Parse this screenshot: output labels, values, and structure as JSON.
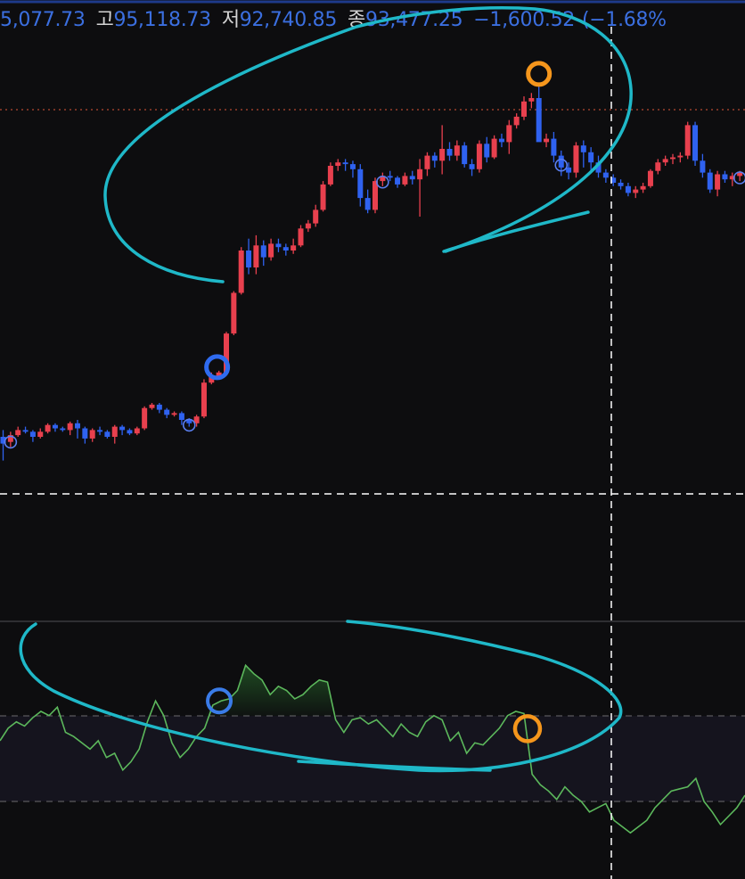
{
  "ohlc_header": {
    "open_value": "5,077.73",
    "high_label": "고",
    "high_value": "95,118.73",
    "low_label": "저",
    "low_value": "92,740.85",
    "close_label": "종",
    "close_value": "93,477.25",
    "change_value": "−1,600.52",
    "change_pct": "(−1.68%"
  },
  "colors": {
    "background": "#0d0d0f",
    "up_candle": "#e8404e",
    "down_candle": "#2f62f0",
    "annotation": "#1fb8c8",
    "marker_orange": "#f5961c",
    "marker_blue": "#2f6bf0",
    "indicator_line": "#5cb85c",
    "header_text": "#3b6fe0"
  },
  "chart_data": [
    {
      "type": "candlestick",
      "candles": [
        [
          0,
          4,
          -14,
          -4
        ],
        [
          -3,
          3,
          -6,
          1
        ],
        [
          1,
          6,
          0,
          4
        ],
        [
          4,
          6,
          2,
          3
        ],
        [
          3,
          4,
          -3,
          0
        ],
        [
          0,
          5,
          -1,
          3
        ],
        [
          3,
          8,
          2,
          7
        ],
        [
          7,
          8,
          3,
          5
        ],
        [
          5,
          6,
          3,
          4
        ],
        [
          4,
          9,
          1,
          8
        ],
        [
          8,
          10,
          -1,
          5
        ],
        [
          5,
          6,
          -4,
          -1
        ],
        [
          -1,
          5,
          -3,
          4
        ],
        [
          4,
          6,
          1,
          3
        ],
        [
          3,
          4,
          -1,
          0
        ],
        [
          0,
          7,
          -4,
          6
        ],
        [
          6,
          7,
          1,
          4
        ],
        [
          4,
          5,
          1,
          2
        ],
        [
          2,
          6,
          1,
          5
        ],
        [
          5,
          18,
          4,
          17
        ],
        [
          17,
          20,
          16,
          19
        ],
        [
          19,
          20,
          14,
          16
        ],
        [
          16,
          17,
          11,
          13
        ],
        [
          13,
          15,
          12,
          14
        ],
        [
          14,
          15,
          7,
          10
        ],
        [
          10,
          11,
          6,
          8
        ],
        [
          8,
          13,
          6,
          12
        ],
        [
          12,
          34,
          11,
          32
        ],
        [
          32,
          38,
          31,
          36
        ],
        [
          36,
          39,
          34,
          38
        ],
        [
          38,
          62,
          37,
          61
        ],
        [
          61,
          86,
          60,
          85
        ],
        [
          85,
          112,
          84,
          110
        ],
        [
          110,
          117,
          96,
          100
        ],
        [
          100,
          119,
          96,
          113
        ],
        [
          113,
          116,
          101,
          106
        ],
        [
          106,
          117,
          104,
          114
        ],
        [
          114,
          117,
          109,
          112
        ],
        [
          112,
          114,
          107,
          110
        ],
        [
          110,
          117,
          108,
          113
        ],
        [
          113,
          125,
          112,
          123
        ],
        [
          123,
          128,
          121,
          126
        ],
        [
          126,
          137,
          124,
          134
        ],
        [
          134,
          151,
          133,
          149
        ],
        [
          149,
          162,
          148,
          160
        ],
        [
          160,
          164,
          157,
          162
        ],
        [
          162,
          164,
          157,
          161
        ],
        [
          161,
          163,
          153,
          158
        ],
        [
          158,
          161,
          136,
          141
        ],
        [
          141,
          146,
          132,
          134
        ],
        [
          134,
          153,
          132,
          151
        ],
        [
          151,
          156,
          148,
          154
        ],
        [
          154,
          157,
          151,
          153
        ],
        [
          153,
          154,
          147,
          149
        ],
        [
          149,
          156,
          148,
          154
        ],
        [
          154,
          157,
          149,
          152
        ],
        [
          152,
          164,
          130,
          158
        ],
        [
          158,
          168,
          154,
          166
        ],
        [
          166,
          168,
          159,
          163
        ],
        [
          163,
          184,
          155,
          170
        ],
        [
          170,
          174,
          163,
          166
        ],
        [
          166,
          175,
          163,
          172
        ],
        [
          172,
          174,
          159,
          161
        ],
        [
          161,
          164,
          154,
          158
        ],
        [
          158,
          175,
          156,
          173
        ],
        [
          173,
          177,
          162,
          165
        ],
        [
          165,
          178,
          164,
          176
        ],
        [
          176,
          179,
          171,
          174
        ],
        [
          174,
          187,
          167,
          184
        ],
        [
          184,
          191,
          182,
          189
        ],
        [
          189,
          201,
          187,
          198
        ],
        [
          198,
          203,
          194,
          200
        ],
        [
          200,
          209,
          191,
          174
        ],
        [
          174,
          179,
          171,
          176
        ],
        [
          176,
          180,
          162,
          166
        ],
        [
          166,
          169,
          154,
          159
        ],
        [
          159,
          162,
          152,
          156
        ],
        [
          156,
          174,
          153,
          172
        ],
        [
          172,
          175,
          159,
          168
        ],
        [
          168,
          171,
          157,
          162
        ],
        [
          162,
          166,
          153,
          156
        ],
        [
          156,
          158,
          150,
          153
        ],
        [
          153,
          155,
          148,
          150
        ],
        [
          150,
          152,
          146,
          148
        ],
        [
          148,
          150,
          142,
          144
        ],
        [
          144,
          148,
          141,
          146
        ],
        [
          146,
          150,
          144,
          148
        ],
        [
          148,
          158,
          147,
          157
        ],
        [
          157,
          164,
          155,
          162
        ],
        [
          162,
          166,
          160,
          164
        ],
        [
          164,
          167,
          161,
          165
        ],
        [
          165,
          168,
          162,
          166
        ],
        [
          166,
          186,
          164,
          184
        ],
        [
          184,
          186,
          160,
          163
        ],
        [
          163,
          167,
          153,
          156
        ],
        [
          156,
          158,
          144,
          146
        ],
        [
          146,
          157,
          142,
          155
        ],
        [
          155,
          157,
          150,
          152
        ],
        [
          152,
          156,
          148,
          154
        ],
        [
          154,
          157,
          151,
          156
        ]
      ],
      "markers": [
        {
          "index": 1,
          "kind": "small-circle"
        },
        {
          "index": 25,
          "kind": "small-circle"
        },
        {
          "index": 51,
          "kind": "small-circle"
        },
        {
          "index": 75,
          "kind": "small-circle"
        },
        {
          "index": 99,
          "kind": "small-circle"
        },
        {
          "index": 29,
          "kind": "big-blue-circle"
        },
        {
          "index": 72,
          "kind": "big-orange-circle"
        }
      ]
    },
    {
      "type": "line",
      "series": [
        {
          "values": [
            46,
            52,
            55,
            53,
            57,
            60,
            58,
            62,
            50,
            48,
            45,
            42,
            46,
            38,
            40,
            32,
            36,
            42,
            55,
            65,
            58,
            45,
            38,
            42,
            48,
            52,
            63,
            65,
            66,
            70,
            82,
            78,
            75,
            68,
            72,
            70,
            66,
            68,
            72,
            75,
            74,
            56,
            50,
            56,
            57,
            54,
            56,
            52,
            48,
            54,
            50,
            48,
            55,
            58,
            56,
            46,
            50,
            40,
            45,
            44,
            48,
            52,
            58,
            60,
            59,
            30,
            25,
            22,
            18,
            24,
            20,
            17,
            12,
            14,
            16,
            8,
            5,
            2,
            5,
            8,
            14,
            18,
            22,
            23,
            24,
            28,
            17,
            12,
            6,
            10,
            14,
            20
          ]
        }
      ],
      "highlight_range": [
        25,
        41
      ],
      "markers": [
        {
          "index": 27,
          "kind": "blue-circle"
        },
        {
          "index": 64,
          "kind": "orange-circle"
        }
      ]
    }
  ]
}
